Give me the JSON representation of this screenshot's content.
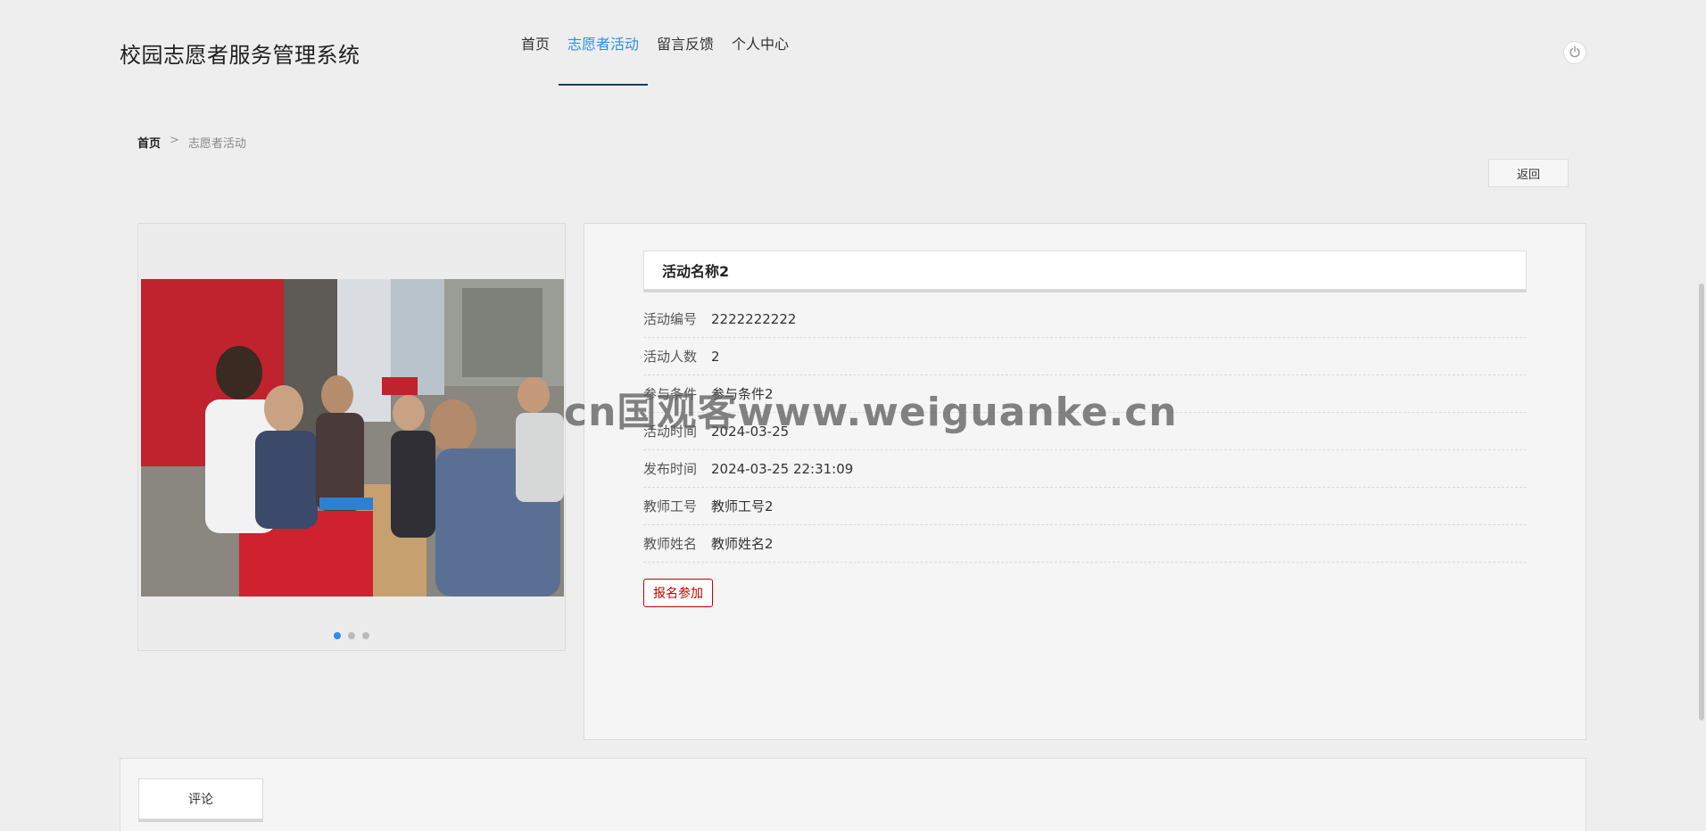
{
  "site": {
    "title": "校园志愿者服务管理系统"
  },
  "nav": {
    "items": [
      {
        "label": "首页"
      },
      {
        "label": "志愿者活动"
      },
      {
        "label": "留言反馈"
      },
      {
        "label": "个人中心"
      }
    ],
    "active_index": 1
  },
  "breadcrumb": {
    "home": "首页",
    "separator": ">",
    "current": "志愿者活动"
  },
  "back_button": {
    "label": "返回"
  },
  "carousel": {
    "slide_count": 3,
    "active_slide": 1,
    "image_icon": "volunteer-photo"
  },
  "activity": {
    "name": "活动名称2",
    "fields": [
      {
        "label": "活动编号",
        "value": "2222222222"
      },
      {
        "label": "活动人数",
        "value": "2"
      },
      {
        "label": "参与条件",
        "value": "参与条件2"
      },
      {
        "label": "活动时间",
        "value": "2024-03-25"
      },
      {
        "label": "发布时间",
        "value": "2024-03-25 22:31:09"
      },
      {
        "label": "教师工号",
        "value": "教师工号2"
      },
      {
        "label": "教师姓名",
        "value": "教师姓名2"
      }
    ],
    "signup_label": "报名参加"
  },
  "comments": {
    "tab_label": "评论"
  },
  "watermark": "cn国观客www.weiguanke.cn",
  "colors": {
    "accent": "#2d8cf0",
    "nav_underline": "#1e3a5f",
    "signup": "#c40000"
  }
}
